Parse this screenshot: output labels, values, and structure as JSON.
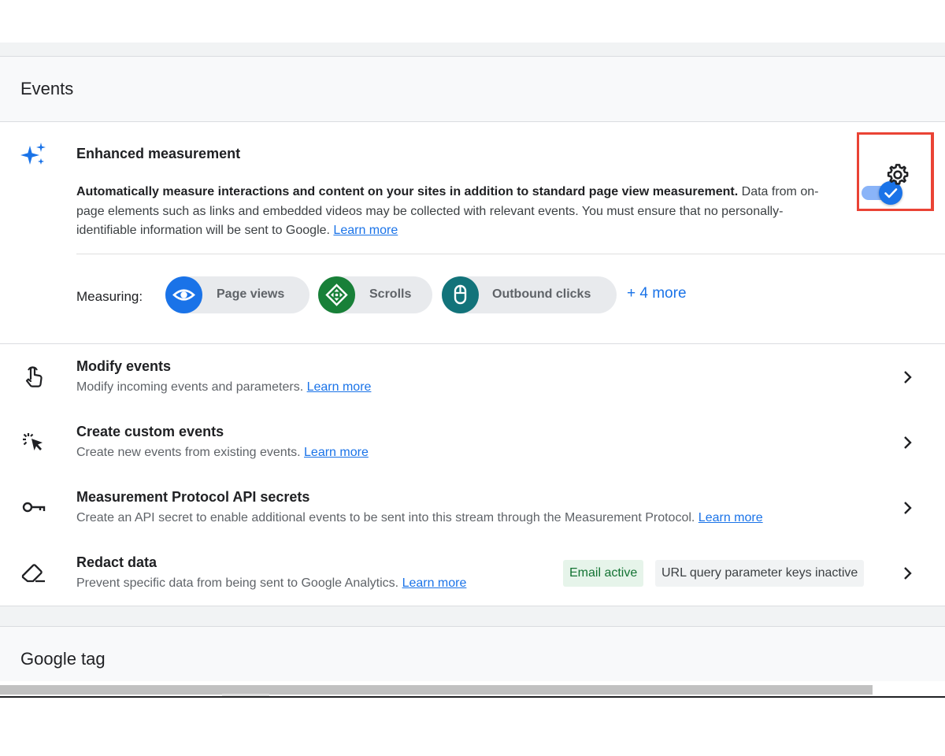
{
  "events_section": {
    "title": "Events"
  },
  "enhanced_measurement": {
    "icon": "sparkle-icon",
    "title": "Enhanced measurement",
    "desc_bold": "Automatically measure interactions and content on your sites in addition to standard page view measurement.",
    "desc_rest": "Data from on-page elements such as links and embedded videos may be collected with relevant events. You must ensure that no personally-identifiable information will be sent to Google.",
    "learn_more": "Learn more",
    "toggle_on": true,
    "measuring_label": "Measuring:",
    "chips": [
      {
        "label": "Page views",
        "icon": "eye-icon",
        "color": "#1a73e8"
      },
      {
        "label": "Scrolls",
        "icon": "scroll-icon",
        "color": "#188038"
      },
      {
        "label": "Outbound clicks",
        "icon": "mouse-icon",
        "color": "#12737a"
      }
    ],
    "more_label": "+ 4 more",
    "settings_icon": "gear-icon"
  },
  "rows": [
    {
      "title": "Modify events",
      "desc": "Modify incoming events and parameters.",
      "link": "Learn more",
      "icon": "touch-icon"
    },
    {
      "title": "Create custom events",
      "desc": "Create new events from existing events.",
      "link": "Learn more",
      "icon": "click-sparkle-icon"
    },
    {
      "title": "Measurement Protocol API secrets",
      "desc": "Create an API secret to enable additional events to be sent into this stream through the Measurement Protocol.",
      "link": "Learn more",
      "icon": "key-icon"
    },
    {
      "title": "Redact data",
      "desc": "Prevent specific data from being sent to Google Analytics.",
      "link": "Learn more",
      "icon": "eraser-icon",
      "badges": [
        "Email active",
        "URL query parameter keys inactive"
      ]
    }
  ],
  "google_tag_section": {
    "title": "Google tag"
  },
  "colors": {
    "accent": "#1a73e8",
    "highlight": "#ea4335"
  }
}
